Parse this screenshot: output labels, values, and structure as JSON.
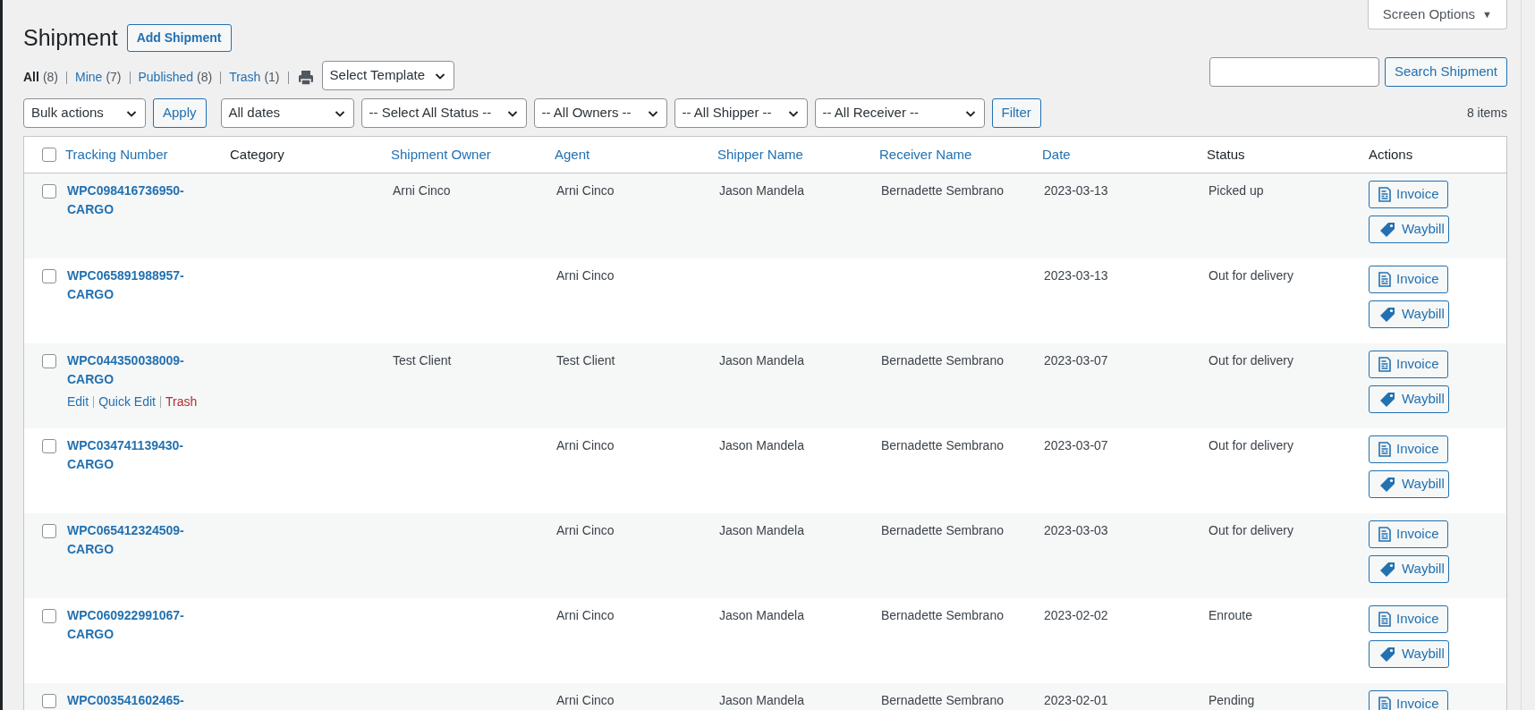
{
  "screen_options": {
    "label": "Screen Options",
    "icon": "▼"
  },
  "page_title": "Shipment",
  "add_button": "Add Shipment",
  "views": [
    {
      "label": "All",
      "count": "(8)",
      "selected": true
    },
    {
      "label": "Mine",
      "count": "(7)",
      "selected": false
    },
    {
      "label": "Published",
      "count": "(8)",
      "selected": false
    },
    {
      "label": "Trash",
      "count": "(1)",
      "selected": false
    }
  ],
  "template_select": "Select Template",
  "search": {
    "button": "Search Shipment"
  },
  "bulk_select": "Bulk actions",
  "apply_button": "Apply",
  "filters": [
    "All dates",
    "-- Select All Status --",
    "-- All Owners --",
    "-- All Shipper --",
    "-- All Receiver --"
  ],
  "filter_button": "Filter",
  "item_count": "8 items",
  "table": {
    "select_all_checked": false,
    "columns": [
      {
        "label": "Tracking Number",
        "sortable": true
      },
      {
        "label": "Category",
        "sortable": false
      },
      {
        "label": "Shipment Owner",
        "sortable": true
      },
      {
        "label": "Agent",
        "sortable": true
      },
      {
        "label": "Shipper Name",
        "sortable": true
      },
      {
        "label": "Receiver Name",
        "sortable": true
      },
      {
        "label": "Date",
        "sortable": true
      },
      {
        "label": "Status",
        "sortable": false
      },
      {
        "label": "Actions",
        "sortable": false
      }
    ],
    "rows": [
      {
        "checked": false,
        "tracking": [
          "WPC098416736950-",
          "CARGO"
        ],
        "owner": "Arni Cinco",
        "agent": "Arni Cinco",
        "shipper": "Jason Mandela",
        "receiver": "Bernadette Sembrano",
        "date": "2023-03-13",
        "status": "Picked up",
        "actions": [
          {
            "kind": "invoice",
            "label": "Invoice"
          },
          {
            "kind": "waybill",
            "label": "Waybill"
          }
        ]
      },
      {
        "checked": false,
        "tracking": [
          "WPC065891988957-",
          "CARGO"
        ],
        "agent": "Arni Cinco",
        "date": "2023-03-13",
        "status": "Out for delivery",
        "actions": [
          {
            "kind": "invoice",
            "label": "Invoice"
          },
          {
            "kind": "waybill",
            "label": "Waybill"
          }
        ]
      },
      {
        "checked": false,
        "tracking": [
          "WPC044350038009-",
          "CARGO"
        ],
        "row_actions": [
          {
            "kind": "link",
            "label": "Edit"
          },
          {
            "kind": "link",
            "label": "Quick Edit"
          },
          {
            "kind": "delete",
            "label": "Trash"
          }
        ],
        "owner": "Test Client",
        "agent": "Test Client",
        "shipper": "Jason Mandela",
        "receiver": "Bernadette Sembrano",
        "date": "2023-03-07",
        "status": "Out for delivery",
        "actions": [
          {
            "kind": "invoice",
            "label": "Invoice"
          },
          {
            "kind": "waybill",
            "label": "Waybill"
          }
        ]
      },
      {
        "checked": false,
        "tracking": [
          "WPC034741139430-",
          "CARGO"
        ],
        "agent": "Arni Cinco",
        "shipper": "Jason Mandela",
        "receiver": "Bernadette Sembrano",
        "date": "2023-03-07",
        "status": "Out for delivery",
        "actions": [
          {
            "kind": "invoice",
            "label": "Invoice"
          },
          {
            "kind": "waybill",
            "label": "Waybill"
          }
        ]
      },
      {
        "checked": false,
        "tracking": [
          "WPC065412324509-",
          "CARGO"
        ],
        "agent": "Arni Cinco",
        "shipper": "Jason Mandela",
        "receiver": "Bernadette Sembrano",
        "date": "2023-03-03",
        "status": "Out for delivery",
        "actions": [
          {
            "kind": "invoice",
            "label": "Invoice"
          },
          {
            "kind": "waybill",
            "label": "Waybill"
          }
        ]
      },
      {
        "checked": false,
        "tracking": [
          "WPC060922991067-",
          "CARGO"
        ],
        "agent": "Arni Cinco",
        "shipper": "Jason Mandela",
        "receiver": "Bernadette Sembrano",
        "date": "2023-02-02",
        "status": "Enroute",
        "actions": [
          {
            "kind": "invoice",
            "label": "Invoice"
          },
          {
            "kind": "waybill",
            "label": "Waybill"
          }
        ]
      },
      {
        "checked": false,
        "tracking": [
          "WPC003541602465-"
        ],
        "agent": "Arni Cinco",
        "shipper": "Jason Mandela",
        "receiver": "Bernadette Sembrano",
        "date": "2023-02-01",
        "status": "Pending",
        "actions": [
          {
            "kind": "invoice",
            "label": "Invoice"
          }
        ]
      }
    ]
  }
}
